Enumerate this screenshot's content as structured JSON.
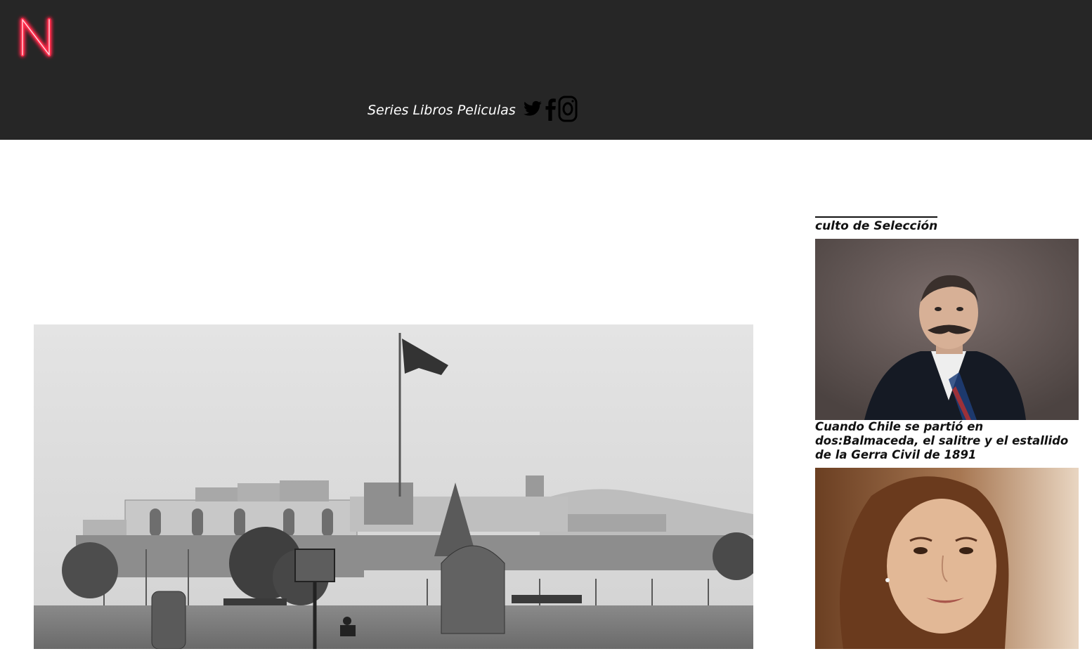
{
  "header": {
    "logo_letter": "N",
    "nav": {
      "series": "Series",
      "libros": "Libros",
      "peliculas": "Peliculas"
    },
    "social_icons": [
      "twitter-icon",
      "facebook-icon",
      "instagram-icon"
    ]
  },
  "sidebar": {
    "title": "culto de Selección",
    "cards": [
      {
        "caption": "Cuando Chile se partió en dos:Balmaceda, el salitre y el estallido de la Gerra Civil de 1891"
      },
      {
        "caption": ""
      }
    ]
  },
  "colors": {
    "header_bg": "#262626",
    "logo_neon": "#ff2a4a",
    "page_bg": "#ffffff",
    "text": "#111111"
  }
}
